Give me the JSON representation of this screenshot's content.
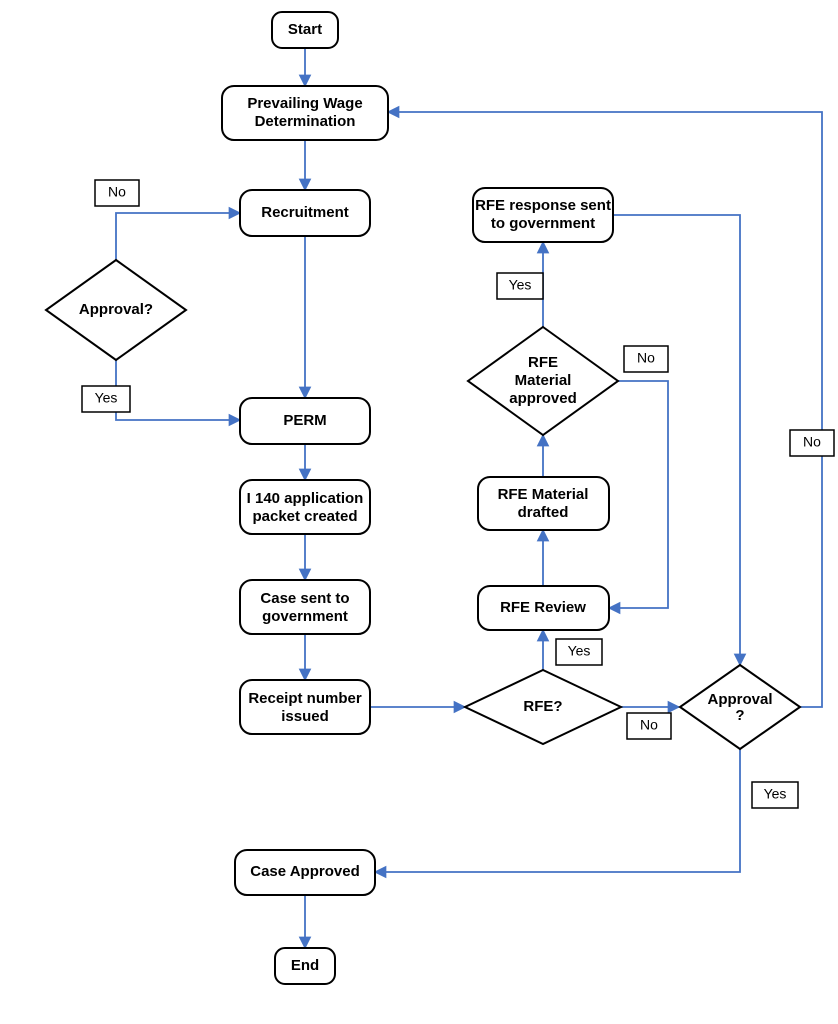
{
  "chart_data": {
    "type": "flowchart",
    "nodes": {
      "start": "Start",
      "pwd": "Prevailing Wage Determination",
      "recruitment": "Recruitment",
      "approval1": "Approval?",
      "perm": "PERM",
      "i140": "I 140 application packet created",
      "case_sent": "Case sent to government",
      "receipt": "Receipt number issued",
      "case_approved": "Case Approved",
      "end": "End",
      "rfe_q": "RFE?",
      "rfe_review": "RFE Review",
      "rfe_drafted": "RFE Material drafted",
      "rfe_approved": "RFE Material approved",
      "rfe_sent": "RFE response sent to government",
      "approval2": "Approval?"
    },
    "labels": {
      "yes": "Yes",
      "no": "No"
    },
    "edges": [
      {
        "from": "start",
        "to": "pwd"
      },
      {
        "from": "pwd",
        "to": "recruitment"
      },
      {
        "from": "recruitment",
        "to": "approval1",
        "label": "No",
        "note": "back edge"
      },
      {
        "from": "approval1",
        "to": "perm",
        "label": "Yes"
      },
      {
        "from": "recruitment",
        "to": "perm"
      },
      {
        "from": "perm",
        "to": "i140"
      },
      {
        "from": "i140",
        "to": "case_sent"
      },
      {
        "from": "case_sent",
        "to": "receipt"
      },
      {
        "from": "receipt",
        "to": "rfe_q"
      },
      {
        "from": "rfe_q",
        "to": "rfe_review",
        "label": "Yes"
      },
      {
        "from": "rfe_review",
        "to": "rfe_drafted"
      },
      {
        "from": "rfe_drafted",
        "to": "rfe_approved"
      },
      {
        "from": "rfe_approved",
        "to": "rfe_sent",
        "label": "Yes"
      },
      {
        "from": "rfe_approved",
        "to": "rfe_review",
        "label": "No"
      },
      {
        "from": "rfe_q",
        "to": "approval2",
        "label": "No"
      },
      {
        "from": "rfe_sent",
        "to": "approval2"
      },
      {
        "from": "approval2",
        "to": "case_approved",
        "label": "Yes"
      },
      {
        "from": "approval2",
        "to": "pwd",
        "label": "No"
      },
      {
        "from": "case_approved",
        "to": "end"
      }
    ]
  }
}
